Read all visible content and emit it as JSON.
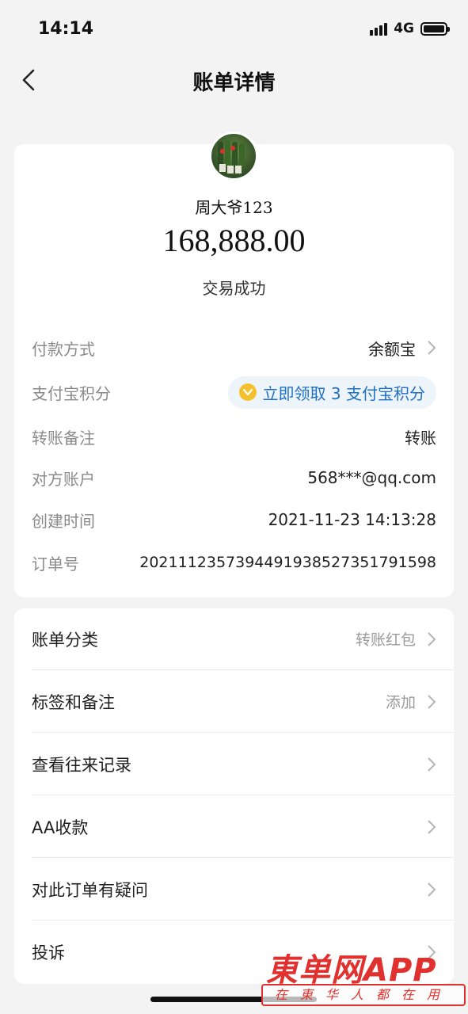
{
  "status_bar": {
    "time": "14:14",
    "network": "4G"
  },
  "nav": {
    "title": "账单详情"
  },
  "transaction": {
    "payee": "周大爷123",
    "amount": "168,888.00",
    "status": "交易成功"
  },
  "details": {
    "payment_method": {
      "label": "付款方式",
      "value": "余额宝"
    },
    "points": {
      "label": "支付宝积分",
      "value": "立即领取 3 支付宝积分"
    },
    "remark": {
      "label": "转账备注",
      "value": "转账"
    },
    "counterparty": {
      "label": "对方账户",
      "value": "568***@qq.com"
    },
    "created": {
      "label": "创建时间",
      "value": "2021-11-23 14:13:28"
    },
    "order_no": {
      "label": "订单号",
      "value": "2021112357394491938527351791598"
    }
  },
  "menu": [
    {
      "label": "账单分类",
      "value": "转账红包"
    },
    {
      "label": "标签和备注",
      "value": "添加"
    },
    {
      "label": "查看往来记录",
      "value": ""
    },
    {
      "label": "AA收款",
      "value": ""
    },
    {
      "label": "对此订单有疑问",
      "value": ""
    },
    {
      "label": "投诉",
      "value": ""
    }
  ],
  "watermark": {
    "main": "東单网APP",
    "sub": "在東华人都在用"
  },
  "colors": {
    "link_blue": "#1f6fc4",
    "watermark_red": "#e0312e",
    "points_gold": "#f3c12e"
  }
}
